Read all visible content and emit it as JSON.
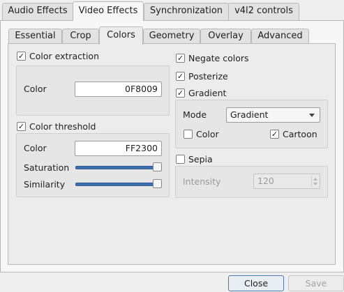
{
  "top_tabs": [
    {
      "label": "Audio Effects",
      "active": false
    },
    {
      "label": "Video Effects",
      "active": true
    },
    {
      "label": "Synchronization",
      "active": false
    },
    {
      "label": "v4l2 controls",
      "active": false
    }
  ],
  "inner_tabs": [
    {
      "label": "Essential",
      "active": false
    },
    {
      "label": "Crop",
      "active": false
    },
    {
      "label": "Colors",
      "active": true
    },
    {
      "label": "Geometry",
      "active": false
    },
    {
      "label": "Overlay",
      "active": false
    },
    {
      "label": "Advanced",
      "active": false
    }
  ],
  "color_extraction": {
    "checkbox_label": "Color extraction",
    "checked": true,
    "color_label": "Color",
    "color_value": "0F8009"
  },
  "color_threshold": {
    "checkbox_label": "Color threshold",
    "checked": true,
    "color_label": "Color",
    "color_value": "FF2300",
    "saturation_label": "Saturation",
    "saturation_level": 1.0,
    "similarity_label": "Similarity",
    "similarity_level": 1.0
  },
  "negate": {
    "label": "Negate colors",
    "checked": true
  },
  "posterize": {
    "label": "Posterize",
    "checked": true
  },
  "gradient": {
    "label": "Gradient",
    "checked": true,
    "mode_label": "Mode",
    "mode_value": "Gradient",
    "color_label": "Color",
    "color_checked": false,
    "cartoon_label": "Cartoon",
    "cartoon_checked": true
  },
  "sepia": {
    "label": "Sepia",
    "checked": false,
    "intensity_label": "Intensity",
    "intensity_value": "120"
  },
  "buttons": {
    "close_label": "Close",
    "save_label": "Save"
  },
  "colors": {
    "slider_fill": "#3c6fad"
  }
}
